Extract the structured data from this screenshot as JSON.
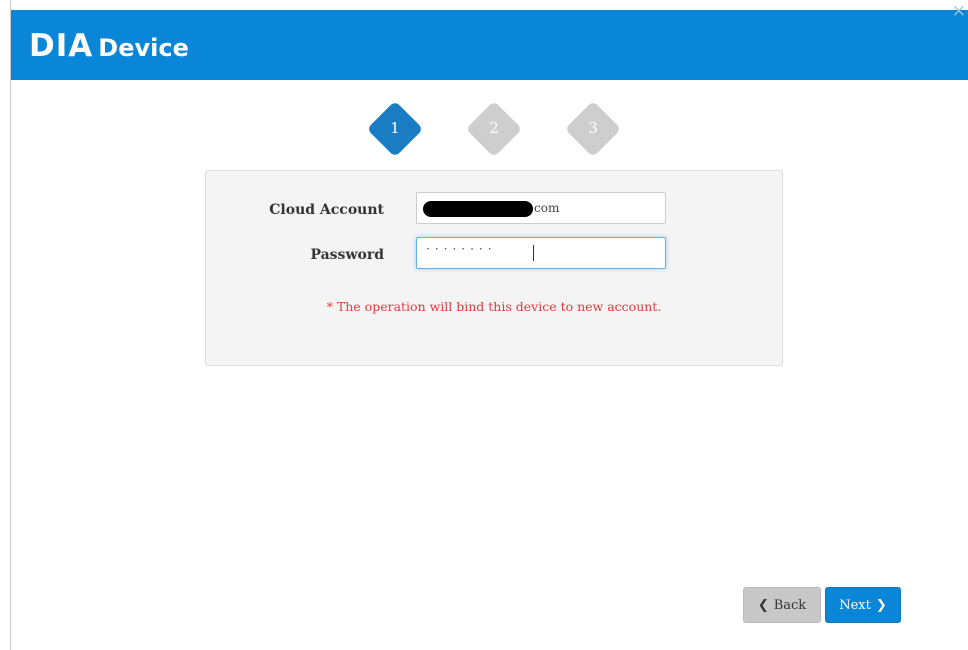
{
  "header": {
    "logo_primary": "DIA",
    "logo_secondary": "Device",
    "close_symbol": "×",
    "background_color": "#0a86d8"
  },
  "steps": [
    {
      "number": "1",
      "state": "active",
      "color": "#1a7dc3"
    },
    {
      "number": "2",
      "state": "inactive",
      "color": "#cecece"
    },
    {
      "number": "3",
      "state": "inactive",
      "color": "#cecece"
    }
  ],
  "form": {
    "account_label": "Cloud Account",
    "account_value_suffix": "com",
    "account_value_redacted": true,
    "password_label": "Password",
    "password_mask": "········",
    "warning": "* The operation will bind this device to new account.",
    "warning_color": "#e8383b"
  },
  "buttons": {
    "back_label": "Back",
    "back_icon": "chevron-left-icon",
    "next_label": "Next",
    "next_icon": "chevron-right-icon"
  }
}
